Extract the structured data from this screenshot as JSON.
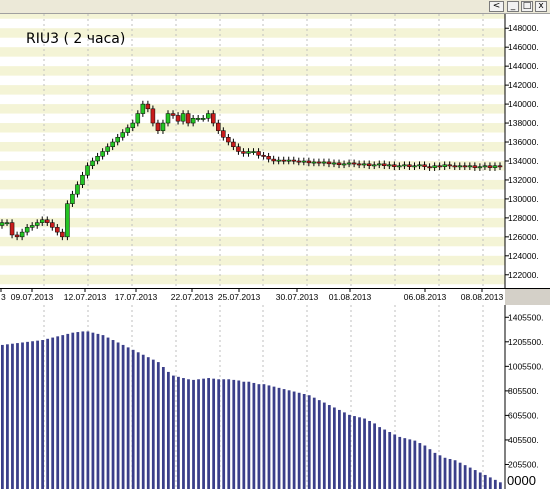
{
  "window": {
    "back_label": "<",
    "min_label": "_",
    "max_label": "□",
    "close_label": "x"
  },
  "chart_title": "RIU3 ( 2 часа)",
  "colors": {
    "band": "#f4f4d6",
    "up_candle": "#24c424",
    "down_candle": "#c81c1c",
    "volume_bar": "#3b3f8a",
    "grid_line": "#bfbfbf"
  },
  "chart_data": [
    {
      "type": "candlestick",
      "title": "RIU3 ( 2 часа)",
      "y_ticks": [
        "148000.",
        "146000.",
        "144000.",
        "142000.",
        "140000.",
        "138000.",
        "136000.",
        "134000.",
        "132000.",
        "130000.",
        "128000.",
        "126000.",
        "124000.",
        "122000."
      ],
      "x_ticks": [
        "3",
        "09.07.2013",
        "12.07.2013",
        "17.07.2013",
        "22.07.2013",
        "25.07.2013",
        "30.07.2013",
        "01.08.2013",
        "06.08.2013",
        "08.08.2013"
      ],
      "ylim": [
        120500,
        149500
      ],
      "close": [
        127500,
        127500,
        126200,
        126000,
        126500,
        127000,
        127200,
        127500,
        127800,
        127500,
        127000,
        126500,
        126000,
        129500,
        130500,
        131500,
        132500,
        133500,
        134000,
        134500,
        135000,
        135500,
        136000,
        136500,
        137000,
        137500,
        138000,
        139000,
        140000,
        139500,
        138000,
        137200,
        138000,
        139000,
        138800,
        138200,
        139000,
        138000,
        138500,
        138500,
        138500,
        139000,
        138000,
        137200,
        136500,
        136000,
        135500,
        135000,
        134800,
        135000,
        135000,
        134600,
        134500,
        134200,
        134000,
        134100,
        134000,
        134100,
        134000,
        133900,
        134000,
        133800,
        133900,
        133800,
        133900,
        133700,
        133800,
        133600,
        133700,
        133800,
        133700,
        133600,
        133700,
        133500,
        133600,
        133700,
        133500,
        133600,
        133400,
        133500,
        133600,
        133400,
        133500,
        133600,
        133400,
        133300,
        133500,
        133400,
        133600,
        133500,
        133400,
        133500,
        133400,
        133500,
        133300,
        133400,
        133500,
        133300,
        133500,
        133400
      ],
      "volume_labels": [
        "1405500.",
        "1205500.",
        "1005500.",
        "805500.",
        "605500.",
        "405500.",
        "205500.",
        "0000"
      ],
      "volume_ylim": [
        5500,
        1505500
      ],
      "volume": [
        1180000,
        1185000,
        1190000,
        1195000,
        1200000,
        1205000,
        1210000,
        1215000,
        1220000,
        1230000,
        1240000,
        1250000,
        1260000,
        1270000,
        1280000,
        1285000,
        1290000,
        1290000,
        1280000,
        1270000,
        1260000,
        1240000,
        1220000,
        1200000,
        1180000,
        1160000,
        1140000,
        1120000,
        1100000,
        1080000,
        1060000,
        1040000,
        1000000,
        960000,
        930000,
        920000,
        910000,
        900000,
        895000,
        900000,
        905000,
        910000,
        905000,
        900000,
        900000,
        900000,
        895000,
        890000,
        880000,
        880000,
        870000,
        860000,
        860000,
        850000,
        840000,
        830000,
        820000,
        810000,
        800000,
        790000,
        780000,
        770000,
        750000,
        730000,
        710000,
        690000,
        670000,
        650000,
        630000,
        610000,
        600000,
        590000,
        580000,
        560000,
        540000,
        510000,
        490000,
        470000,
        450000,
        430000,
        420000,
        410000,
        400000,
        380000,
        360000,
        330000,
        300000,
        280000,
        260000,
        250000,
        240000,
        220000,
        200000,
        180000,
        160000,
        140000,
        120000,
        100000,
        80000,
        60000
      ]
    }
  ]
}
